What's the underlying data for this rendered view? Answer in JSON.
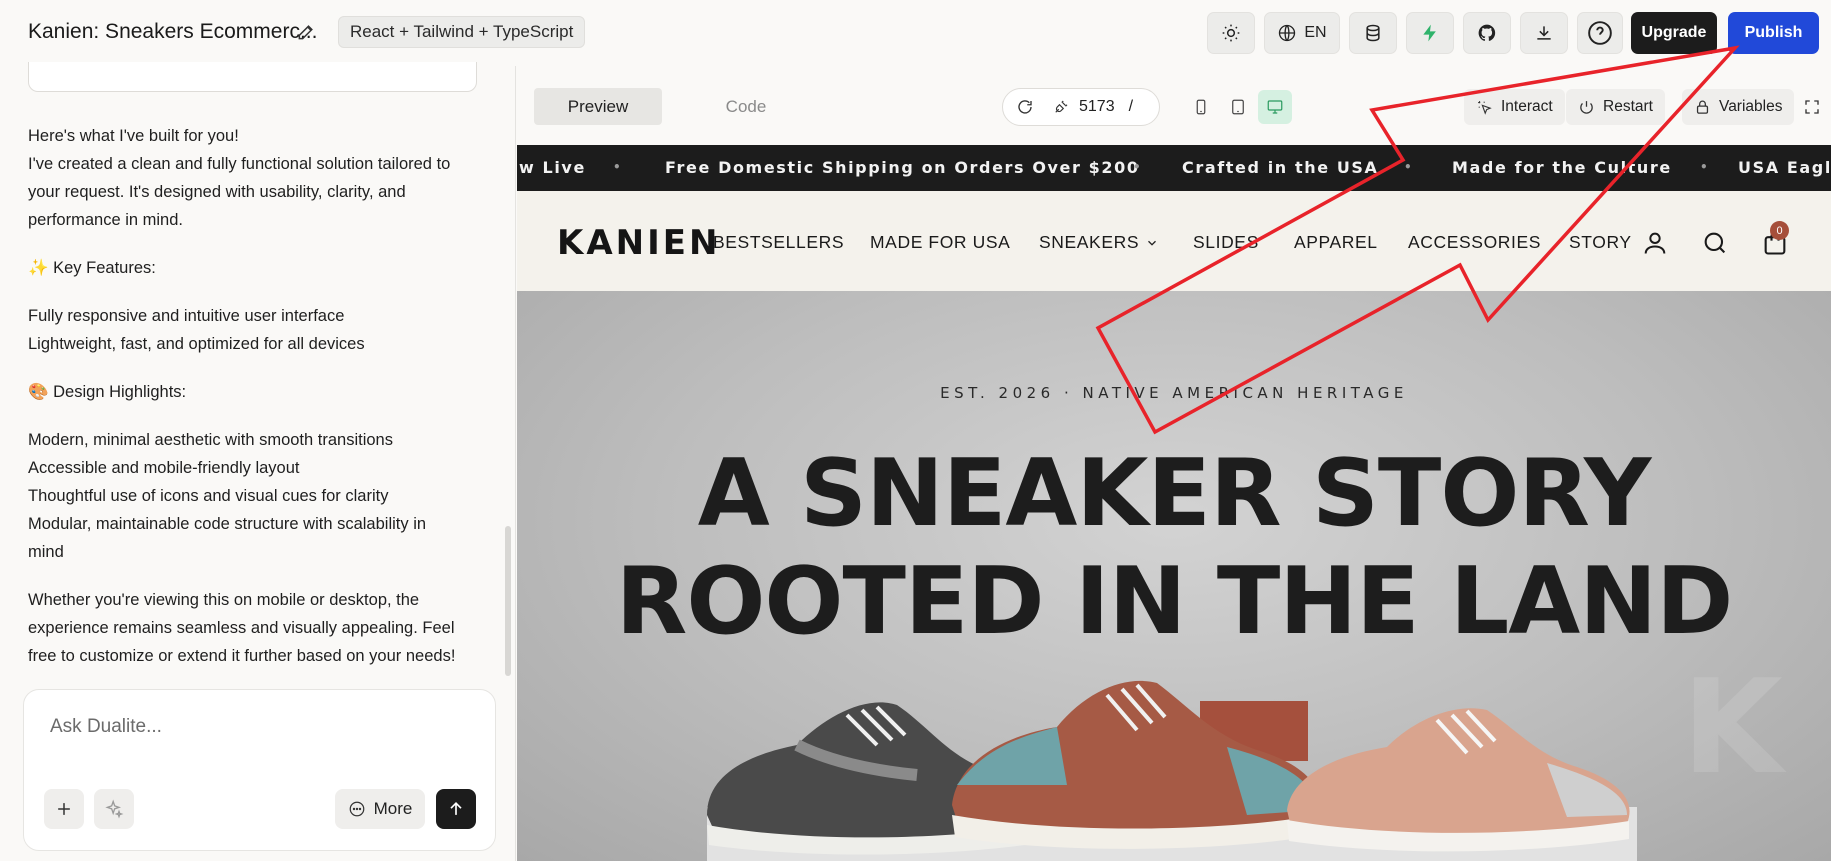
{
  "topbar": {
    "project_title": "Kanien: Sneakers Ecommerc...",
    "stack_badge": "React + Tailwind + TypeScript",
    "language": "EN",
    "upgrade_label": "Upgrade",
    "publish_label": "Publish",
    "icons": [
      "sun-icon",
      "globe-icon",
      "database-icon",
      "bolt-icon",
      "github-icon",
      "download-icon",
      "help-icon"
    ]
  },
  "chat": {
    "intro_heading": "Here's what I've built for you!",
    "intro_lines": [
      "I've created a clean and fully functional solution tailored to",
      "your request. It's designed with usability, clarity, and",
      "performance in mind."
    ],
    "key_features_heading": "✨ Key Features:",
    "key_features": [
      "Fully responsive and intuitive user interface",
      "Lightweight, fast, and optimized for all devices"
    ],
    "design_heading": "🎨 Design Highlights:",
    "design_lines": [
      "Modern, minimal aesthetic with smooth transitions",
      "Accessible and mobile-friendly layout",
      "Thoughtful use of icons and visual cues for clarity",
      "Modular, maintainable code structure with scalability in",
      "mind"
    ],
    "closing_lines": [
      "Whether you're viewing this on mobile or desktop, the",
      "experience remains seamless and visually appealing. Feel",
      "free to customize or extend it further based on your needs!"
    ],
    "composer_placeholder": "Ask Dualite...",
    "more_label": "More"
  },
  "preview_toolbar": {
    "tab_preview": "Preview",
    "tab_code": "Code",
    "port": "5173",
    "path": "/",
    "interact_label": "Interact",
    "restart_label": "Restart",
    "variables_label": "Variables",
    "active_device": "desktop"
  },
  "site": {
    "ticker": [
      "w Live",
      "Free Domestic Shipping on Orders Over $200",
      "Crafted in the USA",
      "Made for the Culture",
      "USA Eagle"
    ],
    "logo": "KANIEN",
    "nav": [
      "BESTSELLERS",
      "MADE FOR USA",
      "SNEAKERS",
      "SLIDES",
      "APPAREL",
      "ACCESSORIES",
      "STORY"
    ],
    "cart_count": "0",
    "hero_kicker": "EST. 2026 · NATIVE AMERICAN HERITAGE",
    "hero_title_line1": "A SNEAKER STORY",
    "hero_title_line2": "ROOTED IN THE LAND",
    "hero_watermark": "K"
  },
  "colors": {
    "publish": "#2149d9",
    "upgrade": "#1c1c1c",
    "ticker_bg": "#1c1c1c",
    "nav_bg": "#f4f2ec",
    "annotation": "#e8232a",
    "cart_badge": "#a64f3a",
    "bolt": "#2fb36b"
  }
}
